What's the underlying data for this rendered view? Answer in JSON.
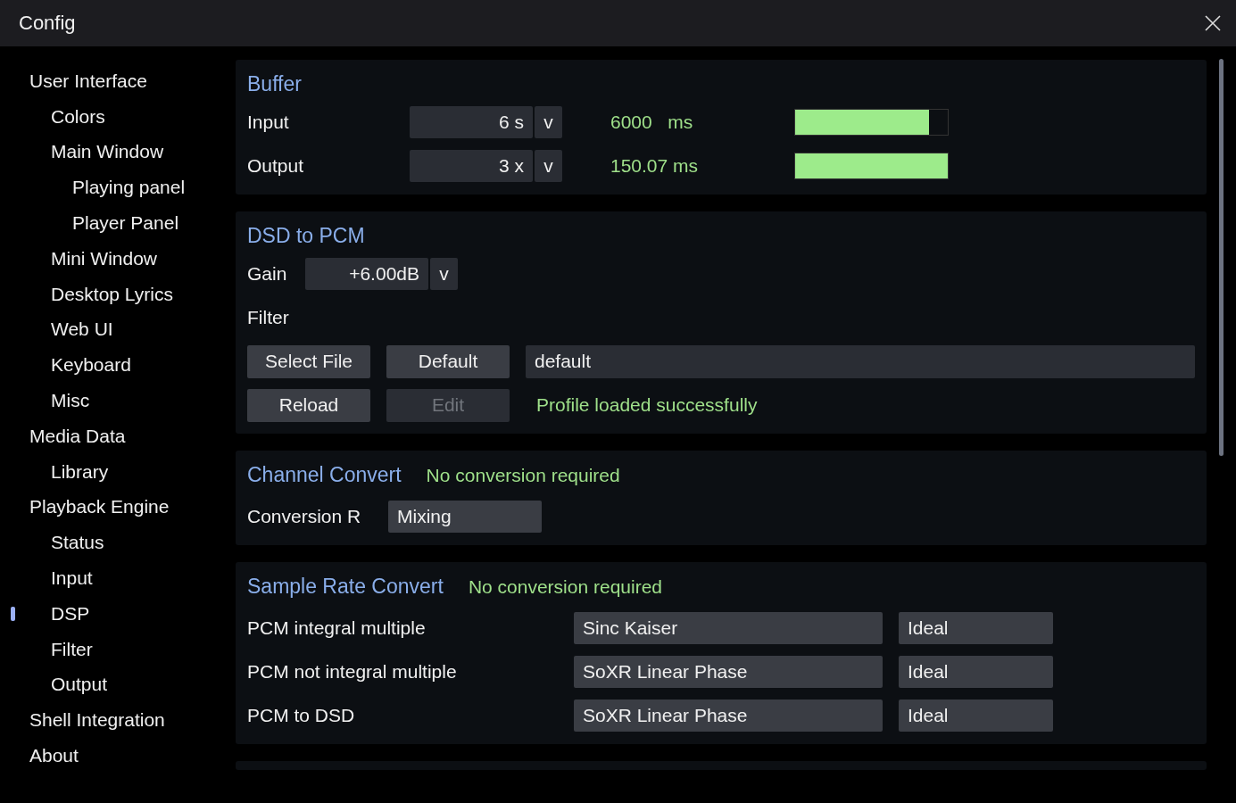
{
  "window": {
    "title": "Config"
  },
  "sidebar": {
    "items": [
      {
        "label": "User Interface",
        "selected": false,
        "children": [
          {
            "label": "Colors",
            "selected": false
          },
          {
            "label": "Main Window",
            "selected": false,
            "children": [
              {
                "label": "Playing panel",
                "selected": false
              },
              {
                "label": "Player Panel",
                "selected": false
              }
            ]
          },
          {
            "label": "Mini Window",
            "selected": false
          },
          {
            "label": "Desktop Lyrics",
            "selected": false
          },
          {
            "label": "Web UI",
            "selected": false
          },
          {
            "label": "Keyboard",
            "selected": false
          },
          {
            "label": "Misc",
            "selected": false
          }
        ]
      },
      {
        "label": "Media Data",
        "selected": false,
        "children": [
          {
            "label": "Library",
            "selected": false
          }
        ]
      },
      {
        "label": "Playback Engine",
        "selected": false,
        "children": [
          {
            "label": "Status",
            "selected": false
          },
          {
            "label": "Input",
            "selected": false
          },
          {
            "label": "DSP",
            "selected": true
          },
          {
            "label": "Filter",
            "selected": false
          },
          {
            "label": "Output",
            "selected": false
          }
        ]
      },
      {
        "label": "Shell Integration",
        "selected": false
      },
      {
        "label": "About",
        "selected": false
      }
    ]
  },
  "buffer": {
    "title": "Buffer",
    "rows": [
      {
        "label": "Input",
        "value": "6 s",
        "caret": "v",
        "reading": "6000   ms",
        "level": 0.88
      },
      {
        "label": "Output",
        "value": "3 x",
        "caret": "v",
        "reading": "150.07 ms",
        "level": 1.0
      }
    ]
  },
  "dsd_to_pcm": {
    "title": "DSD to PCM",
    "gain_label": "Gain",
    "gain_value": "+6.00dB",
    "gain_caret": "v",
    "filter_label": "Filter",
    "buttons": [
      {
        "label": "Select File",
        "disabled": false
      },
      {
        "label": "Default",
        "disabled": false
      },
      {
        "label": "Reload",
        "disabled": false
      },
      {
        "label": "Edit",
        "disabled": true
      }
    ],
    "filter_file": "default",
    "status": "Profile loaded successfully"
  },
  "channel_convert": {
    "title": "Channel Convert",
    "status": "No conversion required",
    "label": "Conversion R",
    "value": "Mixing"
  },
  "sample_rate_convert": {
    "title": "Sample Rate Convert",
    "status": "No conversion required",
    "rows": [
      {
        "label": "PCM integral multiple",
        "method": "Sinc Kaiser",
        "quality": "Ideal"
      },
      {
        "label": "PCM not integral multiple",
        "method": "SoXR Linear Phase",
        "quality": "Ideal"
      },
      {
        "label": "PCM to DSD",
        "method": "SoXR Linear Phase",
        "quality": "Ideal"
      }
    ]
  }
}
